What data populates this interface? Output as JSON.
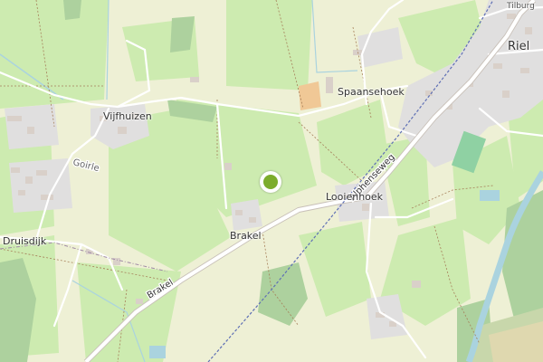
{
  "places": {
    "riel": "Riel",
    "tilburg": "Tilburg",
    "spaansehoek": "Spaansehoek",
    "vijfhuizen": "Vijfhuizen",
    "druisdijk": "Druisdijk",
    "looienhoek": "Looienhoek",
    "brakel": "Brakel"
  },
  "roads": {
    "alphenseweg": "Alphenseweg",
    "brakel_road": "Brakel",
    "goirle": "Goirle"
  },
  "colors": {
    "background": "#f2efe9",
    "farmland": "#eef0d5",
    "meadow": "#cdebb0",
    "forest": "#add19e",
    "residential": "#e0dfdf",
    "building": "#d9d0c9",
    "water": "#aad3df",
    "marker": "#7cac2c"
  },
  "marker": {
    "icon": "location-dot-icon"
  }
}
